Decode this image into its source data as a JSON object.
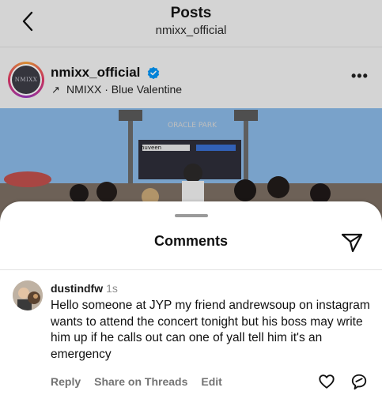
{
  "header": {
    "title": "Posts",
    "subtitle": "nmixx_official"
  },
  "post": {
    "username": "nmixx_official",
    "verified": true,
    "avatar_text": "NMIXX",
    "music": {
      "artist": "NMIXX",
      "separator": "·",
      "song": "Blue Valentine"
    },
    "photo_sign": "ORACLE PARK",
    "photo_board": "nuveen"
  },
  "comments_sheet": {
    "title": "Comments",
    "comment": {
      "username": "dustindfw",
      "time": "1s",
      "text": "Hello someone at JYP my friend andrewsoup on instagram wants to attend the concert tonight but his boss may write him up if he calls out can one of yall tell him it's an emergency",
      "actions": {
        "reply": "Reply",
        "share": "Share on Threads",
        "edit": "Edit"
      }
    }
  },
  "colors": {
    "verified_blue": "#0095f6",
    "secondary_text": "#737373"
  }
}
